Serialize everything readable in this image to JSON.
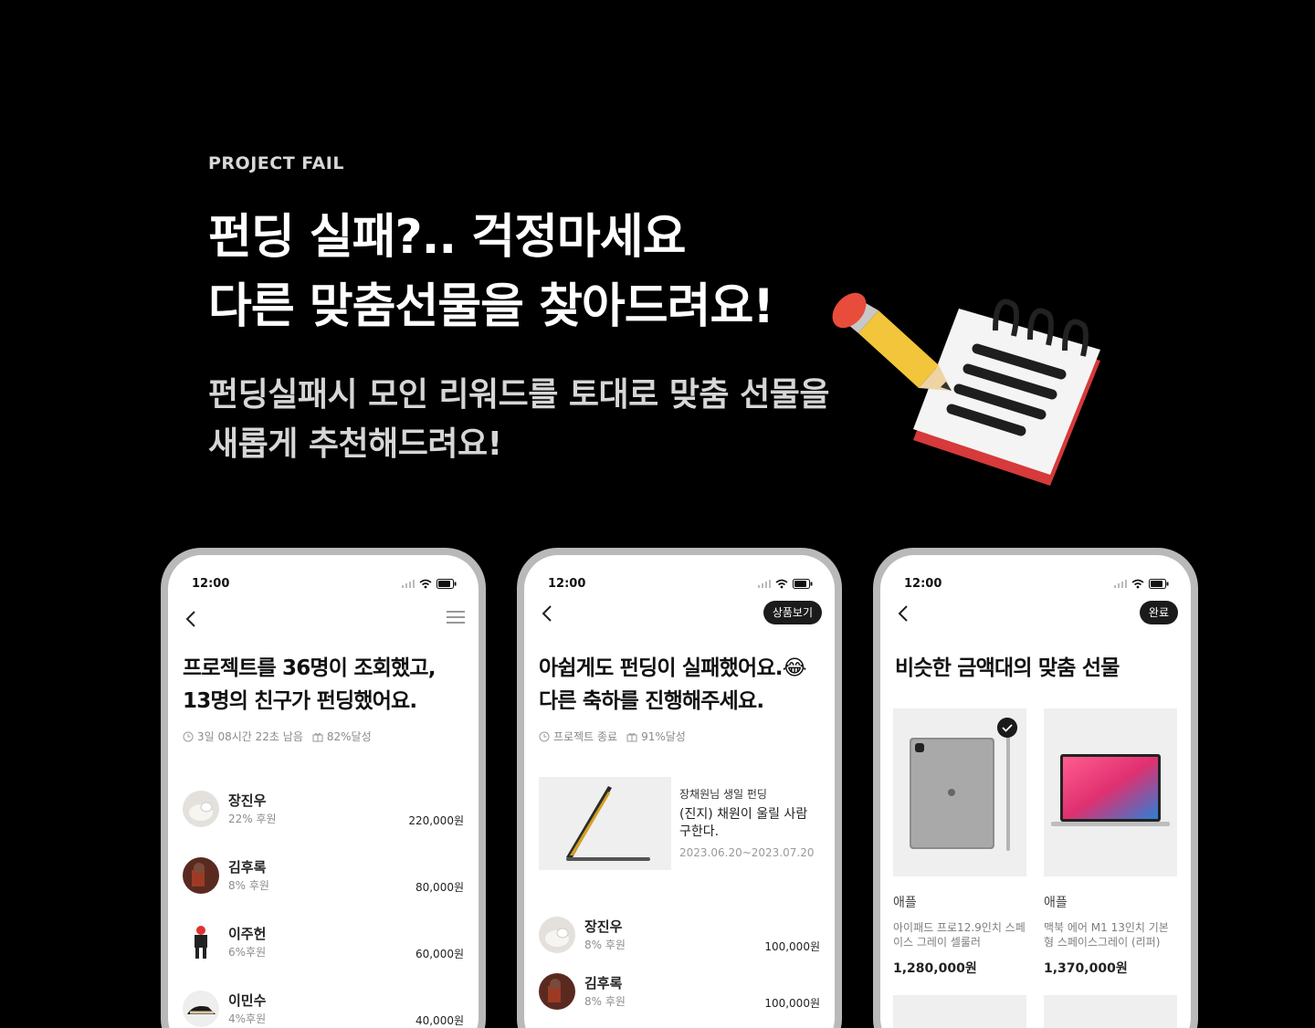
{
  "hero": {
    "eyebrow": "PROJECT FAIL",
    "headline_1": "펀딩 실패?.. 걱정마세요",
    "headline_2": "다른 맞춤선물을 찾아드려요!",
    "sub_1": "펀딩실패시 모인 리워드를 토대로 맞춤 선물을",
    "sub_2": "새롭게 추천해드려요!"
  },
  "phone1": {
    "time": "12:00",
    "title_1": "프로젝트를 36명이 조회했고,",
    "title_2": "13명의 친구가 펀딩했어요.",
    "meta_time": "3일 08시간 22초 남음",
    "meta_goal": "82%달성",
    "donors": [
      {
        "name": "장진우",
        "pct": "22% 후원",
        "amount": "220,000원"
      },
      {
        "name": "김후록",
        "pct": "8% 후원",
        "amount": "80,000원"
      },
      {
        "name": "이주헌",
        "pct": "6%후원",
        "amount": "60,000원"
      },
      {
        "name": "이민수",
        "pct": "4%후원",
        "amount": "40,000원"
      }
    ]
  },
  "phone2": {
    "time": "12:00",
    "action": "상품보기",
    "title_1": "아쉽게도 펀딩이 실패했어요.😂",
    "title_2": "다른 축하를 진행해주세요.",
    "meta_status": "프로젝트 종료",
    "meta_goal": "91%달성",
    "product": {
      "label": "장채원님 생일 펀딩",
      "title": "(진지) 채원이 울릴 사람 구한다.",
      "date": "2023.06.20~2023.07.20"
    },
    "donors": [
      {
        "name": "장진우",
        "pct": "8% 후원",
        "amount": "100,000원"
      },
      {
        "name": "김후록",
        "pct": "8% 후원",
        "amount": "100,000원"
      }
    ]
  },
  "phone3": {
    "time": "12:00",
    "action": "완료",
    "title": "비슷한 금액대의 맞춤 선물",
    "cards": [
      {
        "brand": "애플",
        "name": "아이패드 프로12.9인치 스페이스 그레이 셀룰러",
        "price": "1,280,000원",
        "selected": true
      },
      {
        "brand": "애플",
        "name": "맥북 에어 M1 13인치 기본형 스페이스그레이 (리퍼)",
        "price": "1,370,000원",
        "selected": false
      }
    ]
  },
  "colors": {
    "background": "#000000",
    "phone_frame": "#b9b9b9",
    "pill": "#1b1b1b",
    "pencil": "#f2c53a",
    "notepad_base": "#d63a3a"
  },
  "icons": [
    "back-chevron-icon",
    "menu-icon",
    "clock-icon",
    "gift-icon",
    "signal-icon",
    "wifi-icon",
    "battery-icon",
    "check-icon",
    "pencil-icon",
    "notepad-icon"
  ]
}
